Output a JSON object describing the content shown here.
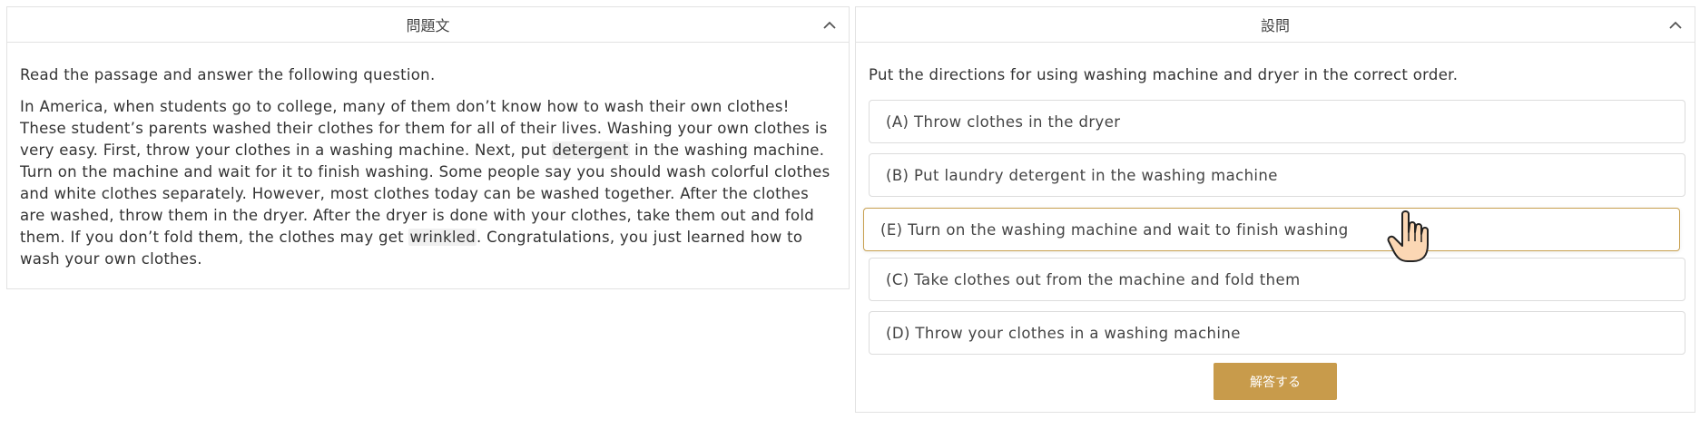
{
  "left_panel": {
    "title": "問題文",
    "instruction": "Read the passage and answer the following question.",
    "passage": {
      "part1": "In America, when students go to college, many of them don’t know how to wash their own clothes! These student’s parents washed their clothes for them for all of their lives. Washing your own clothes is very easy. First, throw your clothes in a washing machine. Next, put ",
      "highlight1": "detergent",
      "part2": " in the washing machine. Turn on the machine and wait for it to finish washing. Some people say you should wash colorful clothes and white clothes separately. However, most clothes today can be washed together. After the clothes are washed, throw them in the dryer. After the dryer is done with your clothes, take them out and fold them. If you don’t fold them, the clothes may get ",
      "highlight2": "wrinkled",
      "part3": ". Congratulations, you just learned how to wash your own clothes."
    }
  },
  "right_panel": {
    "title": "設問",
    "question": "Put the directions for using washing machine and dryer in the correct order.",
    "options": [
      "(A) Throw clothes in the dryer",
      "(B) Put laundry detergent in the washing machine",
      "(E) Turn on the washing machine and wait to finish washing",
      "(C) Take clothes out from the machine and fold them",
      "(D) Throw your clothes in a washing machine"
    ],
    "submit_label": "解答する"
  },
  "colors": {
    "accent": "#c89b4b",
    "drag_border": "#c8a050",
    "border": "#e2e2e2"
  },
  "icons": {
    "collapse": "chevron-up-icon",
    "cursor": "hand-pointer-icon"
  }
}
